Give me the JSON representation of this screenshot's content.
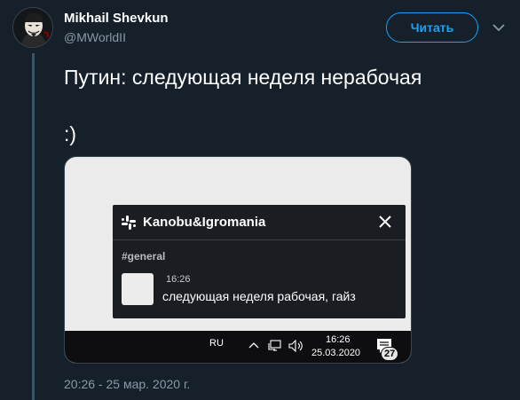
{
  "author": {
    "name": "Mikhail Shevkun",
    "handle": "@MWorldII",
    "avatar_icon": "anonymous-mask-avatar"
  },
  "follow_button": {
    "label": "Читать"
  },
  "more_menu": {
    "icon": "chevron-down-icon"
  },
  "tweet": {
    "text": "Путин: следующая неделя нерабочая",
    "smiley": ":)",
    "timestamp": "20:26 - 25 мар. 2020 г."
  },
  "media": {
    "slack_notification": {
      "workspace": "Kanobu&Igromania",
      "channel": "#general",
      "message_time": "16:26",
      "message_text": "следующая неделя рабочая, гайз"
    },
    "taskbar": {
      "language": "RU",
      "time": "16:26",
      "date": "25.03.2020",
      "notification_count": "27"
    }
  },
  "colors": {
    "background": "#15202b",
    "accent": "#1da1f2",
    "secondary_text": "#8899a6",
    "slack_card": "#1a1d21"
  }
}
